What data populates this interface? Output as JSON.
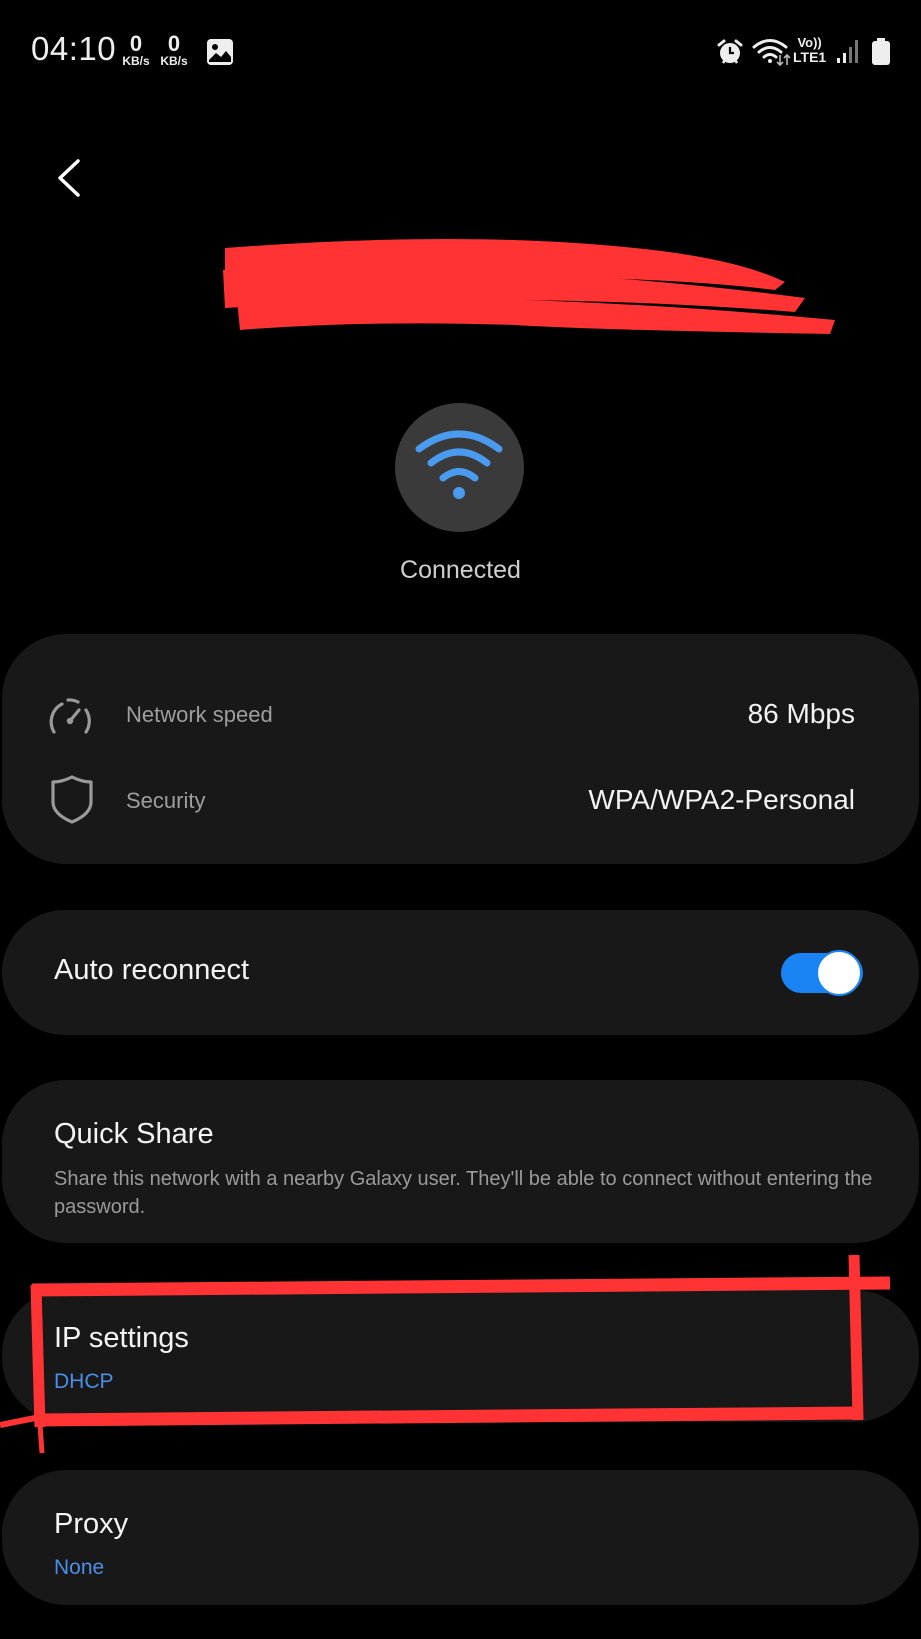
{
  "status_bar": {
    "time": "04:10",
    "download_rate": "0",
    "download_unit": "KB/s",
    "upload_rate": "0",
    "upload_unit": "KB/s",
    "notification_icons": [
      "gallery-icon"
    ],
    "system_icons": [
      "alarm-icon",
      "wifi-icon",
      "volte-icon",
      "signal-icon",
      "battery-icon"
    ],
    "volte_label": "Vo))",
    "lte_label": "LTE1"
  },
  "header": {
    "back_icon": "chevron-left-icon",
    "network_name": "Redacted network name"
  },
  "connection": {
    "icon": "wifi-icon",
    "status": "Connected",
    "accent_color": "#4a9af0"
  },
  "details": [
    {
      "icon": "speedometer-icon",
      "label": "Network speed",
      "value": "86 Mbps"
    },
    {
      "icon": "shield-icon",
      "label": "Security",
      "value": "WPA/WPA2-Personal"
    }
  ],
  "auto_reconnect": {
    "label": "Auto reconnect",
    "enabled": true,
    "toggle_color": "#1a84f5"
  },
  "quick_share": {
    "title": "Quick Share",
    "description": "Share this network with a nearby Galaxy user. They'll be able to connect without entering the password."
  },
  "ip_settings": {
    "title": "IP settings",
    "value": "DHCP",
    "value_color": "#4a8ee8"
  },
  "proxy": {
    "title": "Proxy",
    "value": "None",
    "value_color": "#4a8ee8"
  },
  "annotations": {
    "redaction_color": "#ff3333",
    "highlight_target": "IP settings"
  }
}
